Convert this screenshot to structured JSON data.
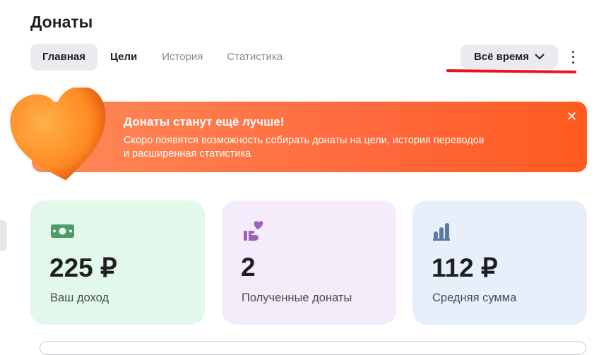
{
  "header": {
    "title": "Донаты"
  },
  "tabs": [
    {
      "label": "Главная"
    },
    {
      "label": "Цели"
    },
    {
      "label": "История"
    },
    {
      "label": "Статистика"
    }
  ],
  "period": {
    "label": "Всё время"
  },
  "banner": {
    "title": "Донаты станут ещё лучше!",
    "text_line1": "Скоро появятся возможность собирать донаты на цели, история переводов",
    "text_line2": "и расширенная статистика",
    "close": "✕"
  },
  "cards": [
    {
      "value": "225 ₽",
      "label": "Ваш доход",
      "bg": "#e1f8ea",
      "icon_color": "#4f9a6a"
    },
    {
      "value": "2",
      "label": "Полученные донаты",
      "bg": "#f4ecfb",
      "icon_color": "#9a64b4"
    },
    {
      "value": "112 ₽",
      "label": "Средняя сумма",
      "bg": "#e7f0fa",
      "icon_color": "#5a7aa3"
    }
  ]
}
